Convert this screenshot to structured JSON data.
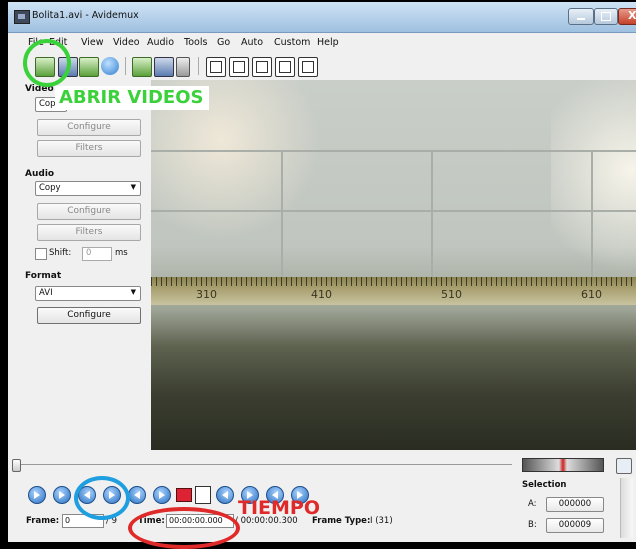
{
  "window": {
    "title": "Bolita1.avi - Avidemux",
    "close_glyph": "X"
  },
  "menu": [
    "File",
    "Edit",
    "View",
    "Video",
    "Audio",
    "Tools",
    "Go",
    "Auto",
    "Custom",
    "Help"
  ],
  "toolbar_icons": [
    "open-video-icon",
    "save-video-icon",
    "append-icon",
    "info-icon",
    "load-icon",
    "save-icon",
    "calculator-icon",
    "frame-mode-icon",
    "output-mode-icon",
    "split-layout-icon",
    "stack-layout-icon",
    "window-icon"
  ],
  "video_panel": {
    "label": "Video",
    "codec_value": "Copy",
    "configure_label": "Configure",
    "filters_label": "Filters"
  },
  "audio_panel": {
    "label": "Audio",
    "codec_value": "Copy",
    "configure_label": "Configure",
    "filters_label": "Filters",
    "shift_label": "Shift:",
    "shift_value": "0",
    "shift_unit": "ms"
  },
  "format_panel": {
    "label": "Format",
    "container_value": "AVI",
    "configure_label": "Configure"
  },
  "video_frame": {
    "ruler_numbers": [
      "310",
      "410",
      "510",
      "610"
    ]
  },
  "status": {
    "frame_label": "Frame:",
    "frame_value": "0",
    "frame_total": "/ 9",
    "time_label": "Time:",
    "time_value": "00:00:00.000",
    "time_total": "/ 00:00:00.300",
    "frame_type_label": "Frame Type:",
    "frame_type_value": "I (31)"
  },
  "selection": {
    "label": "Selection",
    "a_label": "A:",
    "a_value": "000000",
    "b_label": "B:",
    "b_value": "000009"
  },
  "annotations": {
    "open_videos": "ABRIR VIDEOS",
    "time": "TIEMPO"
  },
  "colors": {
    "annotation_green": "#3bd13a",
    "annotation_blue": "#1f9fe0",
    "annotation_red": "#e02a2a"
  }
}
